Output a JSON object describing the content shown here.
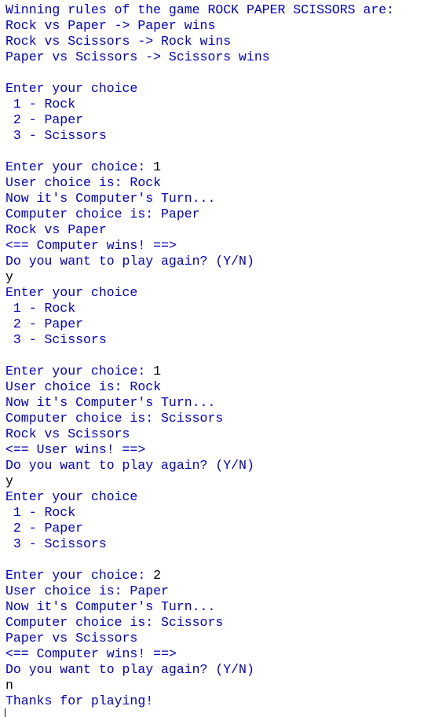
{
  "console": {
    "lines": [
      {
        "text": "Winning rules of the game ROCK PAPER SCISSORS are:",
        "kind": "out"
      },
      {
        "text": "Rock vs Paper -> Paper wins",
        "kind": "out"
      },
      {
        "text": "Rock vs Scissors -> Rock wins",
        "kind": "out"
      },
      {
        "text": "Paper vs Scissors -> Scissors wins",
        "kind": "out"
      },
      {
        "text": "",
        "kind": "out"
      },
      {
        "text": "Enter your choice",
        "kind": "out"
      },
      {
        "text": " 1 - Rock",
        "kind": "out"
      },
      {
        "text": " 2 - Paper",
        "kind": "out"
      },
      {
        "text": " 3 - Scissors",
        "kind": "out"
      },
      {
        "text": "",
        "kind": "out"
      },
      {
        "segments": [
          {
            "text": "Enter your choice: ",
            "kind": "out"
          },
          {
            "text": "1",
            "kind": "inp"
          }
        ]
      },
      {
        "text": "User choice is: Rock",
        "kind": "out"
      },
      {
        "text": "Now it's Computer's Turn...",
        "kind": "out"
      },
      {
        "text": "Computer choice is: Paper",
        "kind": "out"
      },
      {
        "text": "Rock vs Paper",
        "kind": "out"
      },
      {
        "text": "<== Computer wins! ==>",
        "kind": "out"
      },
      {
        "text": "Do you want to play again? (Y/N)",
        "kind": "out"
      },
      {
        "text": "y",
        "kind": "inp"
      },
      {
        "text": "Enter your choice",
        "kind": "out"
      },
      {
        "text": " 1 - Rock",
        "kind": "out"
      },
      {
        "text": " 2 - Paper",
        "kind": "out"
      },
      {
        "text": " 3 - Scissors",
        "kind": "out"
      },
      {
        "text": "",
        "kind": "out"
      },
      {
        "segments": [
          {
            "text": "Enter your choice: ",
            "kind": "out"
          },
          {
            "text": "1",
            "kind": "inp"
          }
        ]
      },
      {
        "text": "User choice is: Rock",
        "kind": "out"
      },
      {
        "text": "Now it's Computer's Turn...",
        "kind": "out"
      },
      {
        "text": "Computer choice is: Scissors",
        "kind": "out"
      },
      {
        "text": "Rock vs Scissors",
        "kind": "out"
      },
      {
        "text": "<== User wins! ==>",
        "kind": "out"
      },
      {
        "text": "Do you want to play again? (Y/N)",
        "kind": "out"
      },
      {
        "text": "y",
        "kind": "inp"
      },
      {
        "text": "Enter your choice",
        "kind": "out"
      },
      {
        "text": " 1 - Rock",
        "kind": "out"
      },
      {
        "text": " 2 - Paper",
        "kind": "out"
      },
      {
        "text": " 3 - Scissors",
        "kind": "out"
      },
      {
        "text": "",
        "kind": "out"
      },
      {
        "segments": [
          {
            "text": "Enter your choice: ",
            "kind": "out"
          },
          {
            "text": "2",
            "kind": "inp"
          }
        ]
      },
      {
        "text": "User choice is: Paper",
        "kind": "out"
      },
      {
        "text": "Now it's Computer's Turn...",
        "kind": "out"
      },
      {
        "text": "Computer choice is: Scissors",
        "kind": "out"
      },
      {
        "text": "Paper vs Scissors",
        "kind": "out"
      },
      {
        "text": "<== Computer wins! ==>",
        "kind": "out"
      },
      {
        "text": "Do you want to play again? (Y/N)",
        "kind": "out"
      },
      {
        "text": "n",
        "kind": "inp"
      },
      {
        "text": "Thanks for playing!",
        "kind": "out"
      }
    ]
  }
}
